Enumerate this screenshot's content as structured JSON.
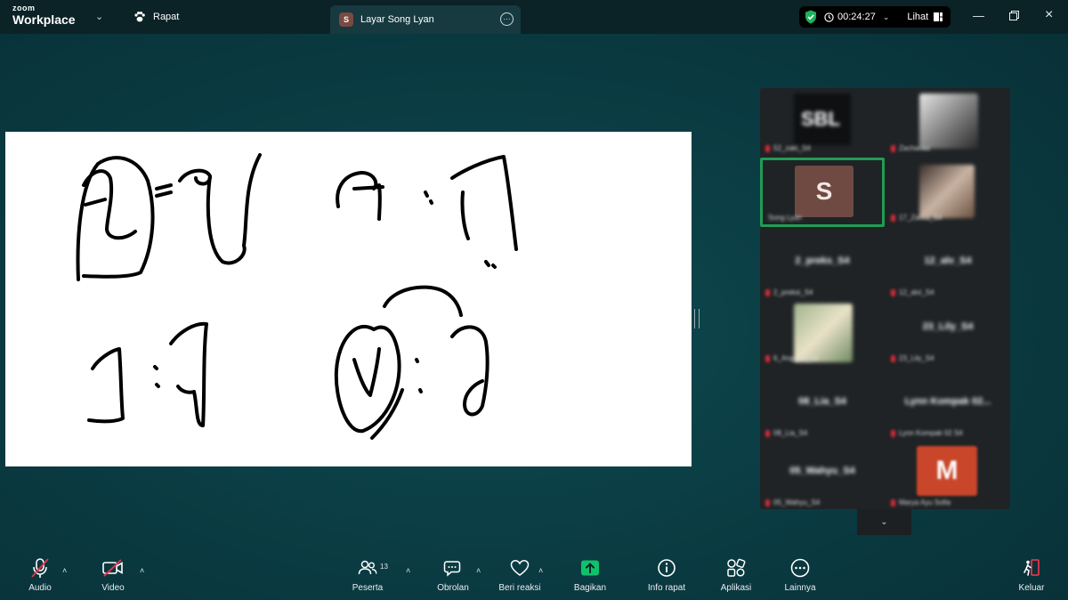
{
  "topbar": {
    "logo_small": "zoom",
    "logo_big": "Workplace",
    "meeting_label": "Rapat",
    "share_tab_avatar": "S",
    "share_tab_label": "Layar Song Lyan",
    "timer": "00:24:27",
    "view_label": "Lihat"
  },
  "gallery": {
    "tiles": [
      {
        "name": "52_zaki_S4"
      },
      {
        "name": "Zacharias"
      },
      {
        "name": "Song Lyan",
        "avatar": "S"
      },
      {
        "name": "17_Zahra_S4"
      },
      {
        "name": "2_preksi_S4",
        "center": "2_preks_S4"
      },
      {
        "name": "12_alvi_S4",
        "center": "12_alv_S4"
      },
      {
        "name": "6_Anggun_S4"
      },
      {
        "name": "23_Lily_S4",
        "center": "23_Lily_S4"
      },
      {
        "name": "08_Lia_S4",
        "center": "08_Lia_S4"
      },
      {
        "name": "Lynn Kompak 02 S4",
        "center": "Lynn Kompak 02..."
      },
      {
        "name": "05_Wahyu_S4",
        "center": "05_Wahyu_S4"
      },
      {
        "name": "Marya Ayu Sofia",
        "avatar": "M"
      }
    ]
  },
  "toolbar": {
    "audio": "Audio",
    "video": "Video",
    "participants": "Peserta",
    "participants_count": "13",
    "chat": "Obrolan",
    "react": "Beri reaksi",
    "share": "Bagikan",
    "info": "Info rapat",
    "apps": "Aplikasi",
    "more": "Lainnya",
    "leave": "Keluar"
  },
  "colors": {
    "topbar": "#0b2226",
    "background": "#0b3d44",
    "gallery": "#1f2325",
    "active_speaker": "#1f9d55",
    "share_green": "#0ec26b",
    "muted_red": "#d92c3a"
  }
}
